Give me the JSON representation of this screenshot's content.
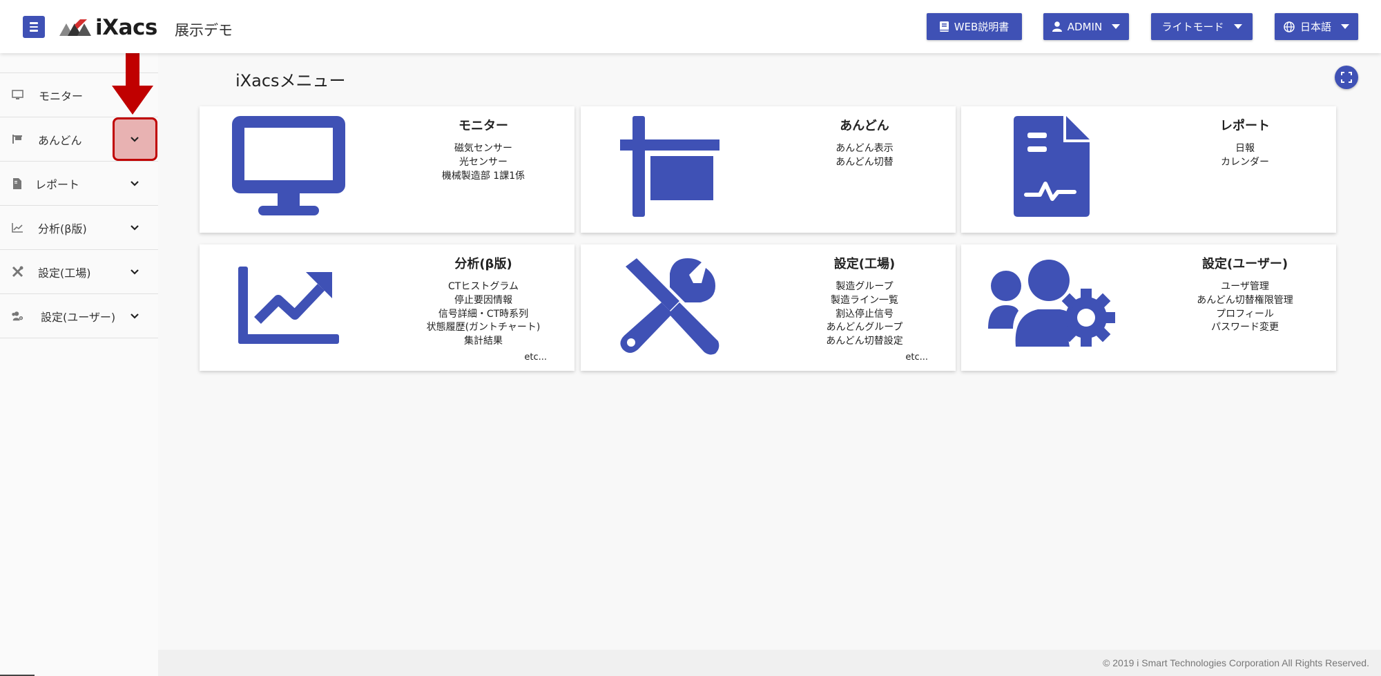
{
  "header": {
    "logo_text": "iXacs",
    "app_title": "展示デモ",
    "buttons": {
      "manual": "WEB説明書",
      "user": "ADMIN",
      "theme": "ライトモード",
      "language": "日本語"
    }
  },
  "sidebar": {
    "items": [
      {
        "label": "モニター",
        "icon": "monitor-icon"
      },
      {
        "label": "あんどん",
        "icon": "flag-icon"
      },
      {
        "label": "レポート",
        "icon": "file-icon"
      },
      {
        "label": "分析(β版)",
        "icon": "chart-line-icon"
      },
      {
        "label": "設定(工場)",
        "icon": "tools-icon"
      },
      {
        "label": "設定(ユーザー)",
        "icon": "users-cog-icon"
      }
    ]
  },
  "main": {
    "title": "iXacsメニュー",
    "cards": [
      {
        "title": "モニター",
        "icon": "desktop-icon",
        "items": [
          "磁気センサー",
          "光センサー",
          "機械製造部 1課1係"
        ],
        "etc": ""
      },
      {
        "title": "あんどん",
        "icon": "sign-icon",
        "items": [
          "あんどん表示",
          "あんどん切替"
        ],
        "etc": ""
      },
      {
        "title": "レポート",
        "icon": "file-medical-icon",
        "items": [
          "日報",
          "カレンダー"
        ],
        "etc": ""
      },
      {
        "title": "分析(β版)",
        "icon": "chart-line-icon",
        "items": [
          "CTヒストグラム",
          "停止要因情報",
          "信号詳細・CT時系列",
          "状態履歴(ガントチャート)",
          "集計結果"
        ],
        "etc": "etc..."
      },
      {
        "title": "設定(工場)",
        "icon": "tools-icon",
        "items": [
          "製造グループ",
          "製造ライン一覧",
          "割込停止信号",
          "あんどんグループ",
          "あんどん切替設定"
        ],
        "etc": "etc..."
      },
      {
        "title": "設定(ユーザー)",
        "icon": "users-cog-icon",
        "items": [
          "ユーザ管理",
          "あんどん切替権限管理",
          "プロフィール",
          "パスワード変更"
        ],
        "etc": ""
      }
    ]
  },
  "footer": {
    "copyright": "© 2019 i Smart Technologies Corporation All Rights Reserved."
  },
  "colors": {
    "accent": "#3f51b5",
    "highlight": "#c00000"
  }
}
